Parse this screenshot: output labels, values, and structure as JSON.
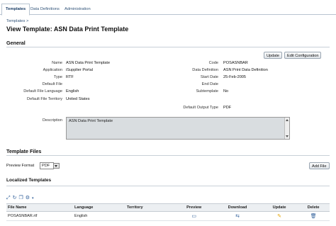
{
  "tabs": [
    {
      "label": "Templates",
      "active": true
    },
    {
      "label": "Data Definitions",
      "active": false
    },
    {
      "label": "Administration",
      "active": false
    }
  ],
  "breadcrumb": "Templates >",
  "page_title": "View Template: ASN Data Print Template",
  "general": {
    "heading": "General",
    "update_label": "Update",
    "edit_config_label": "Edit Configuration",
    "left": [
      {
        "label": "Name",
        "value": "ASN Data Print Template"
      },
      {
        "label": "Application",
        "value": "iSupplier Portal"
      },
      {
        "label": "Type",
        "value": "RTF"
      },
      {
        "label": "Default File",
        "value": ""
      },
      {
        "label": "Default File Language",
        "value": "English"
      },
      {
        "label": "Default File Territory",
        "value": "United States"
      }
    ],
    "right": [
      {
        "label": "Code",
        "value": "POSASNBAR"
      },
      {
        "label": "Data Definition",
        "value": "ASN Print Data Definition"
      },
      {
        "label": "Start Date",
        "value": "25-Feb-2005"
      },
      {
        "label": "End Date",
        "value": ""
      },
      {
        "label": "Subtemplate",
        "value": "No"
      },
      {
        "label": "Default Output Type",
        "value": "PDF"
      }
    ],
    "description_label": "Description",
    "description_value": "ASN Data Print Template"
  },
  "template_files": {
    "heading": "Template Files",
    "preview_format_label": "Preview Format",
    "preview_format_value": "PDF",
    "add_file_label": "Add File"
  },
  "localized": {
    "heading": "Localized Templates",
    "columns": [
      "File Name",
      "Language",
      "Territory",
      "Preview",
      "Download",
      "Update",
      "Delete"
    ],
    "rows": [
      {
        "file_name": "POSASNBAR.rtf",
        "language": "English",
        "territory": ""
      }
    ]
  },
  "icons": {
    "accent": "#2f5f9a",
    "update_color": "#e6a400"
  }
}
